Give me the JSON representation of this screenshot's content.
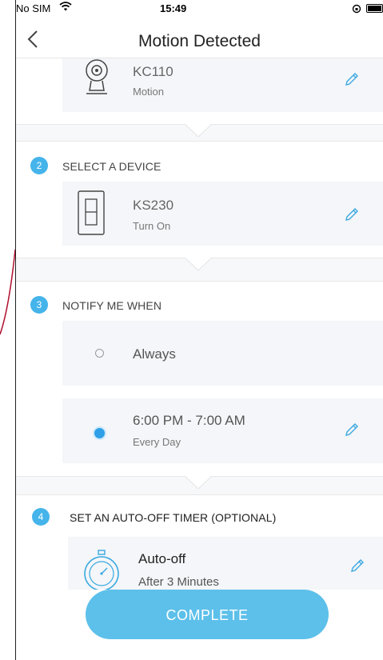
{
  "status_bar": {
    "carrier": "No SIM",
    "time": "15:49"
  },
  "nav": {
    "title": "Motion Detected"
  },
  "trigger": {
    "device_name": "KC110",
    "device_event": "Motion"
  },
  "step2": {
    "number": "2",
    "label": "SELECT A DEVICE",
    "device_name": "KS230",
    "device_action": "Turn On"
  },
  "step3": {
    "number": "3",
    "label": "NOTIFY ME WHEN",
    "options": [
      {
        "label": "Always",
        "selected": false
      },
      {
        "label": "6:00 PM - 7:00 AM",
        "sublabel": "Every Day",
        "selected": true
      }
    ]
  },
  "step4": {
    "number": "4",
    "label": "SET AN AUTO-OFF TIMER (OPTIONAL)",
    "timer_name": "Auto-off",
    "timer_value": "After 3 Minutes"
  },
  "complete_label": "COMPLETE",
  "icons": [
    "wifi-icon",
    "back-chevron-icon",
    "camera-icon",
    "pencil-icon",
    "switch-icon",
    "timer-icon"
  ],
  "colors": {
    "accent": "#45b4ea",
    "button": "#5dc0ea",
    "radio_selected": "#2f9fe8"
  }
}
